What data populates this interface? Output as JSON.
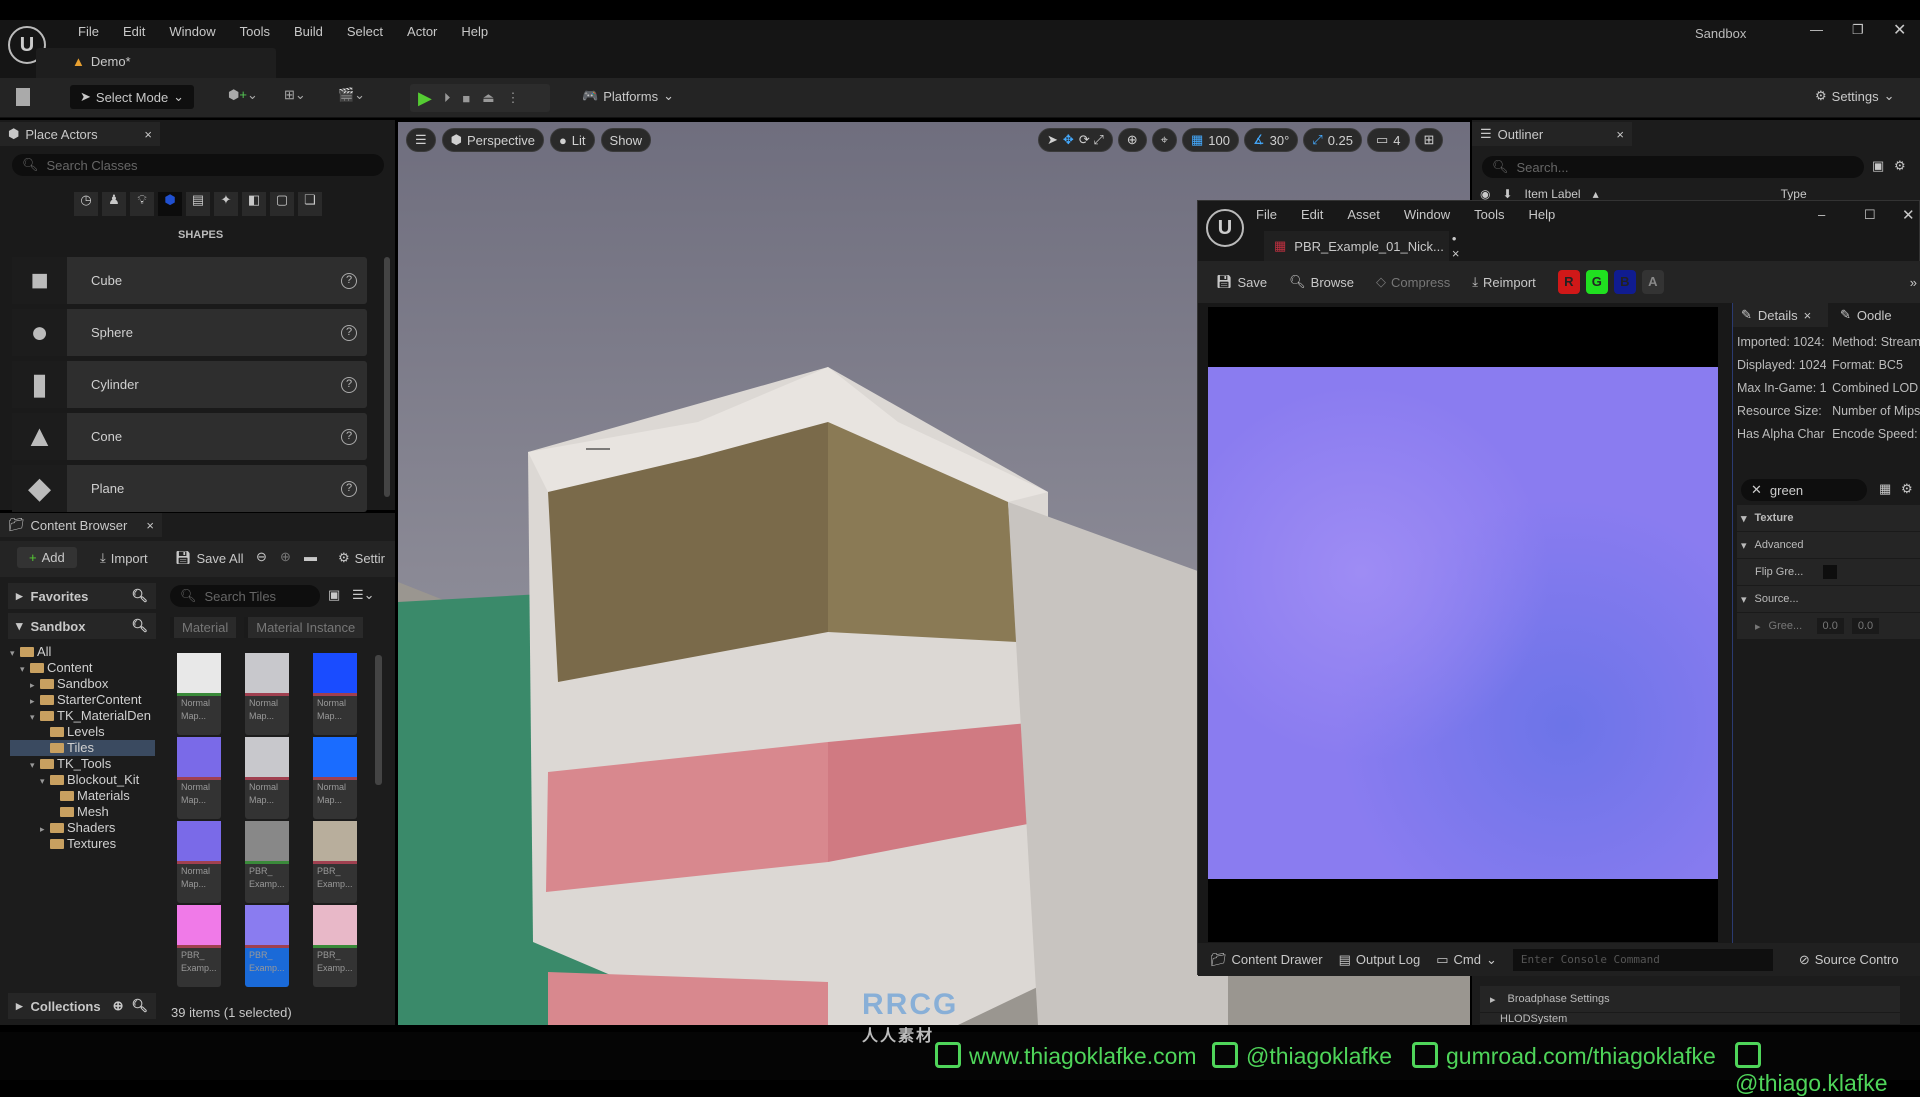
{
  "app": {
    "menu": [
      "File",
      "Edit",
      "Window",
      "Tools",
      "Build",
      "Select",
      "Actor",
      "Help"
    ],
    "project": "Sandbox",
    "level_tab": "Demo*"
  },
  "toolbar": {
    "select_mode": "Select Mode",
    "platforms": "Platforms",
    "settings": "Settings"
  },
  "place_actors": {
    "title": "Place Actors",
    "search_placeholder": "Search Classes",
    "category": "SHAPES",
    "items": [
      "Cube",
      "Sphere",
      "Cylinder",
      "Cone",
      "Plane"
    ]
  },
  "content_browser": {
    "title": "Content Browser",
    "add": "Add",
    "import": "Import",
    "save_all": "Save All",
    "settings": "Settir",
    "favorites": "Favorites",
    "sandbox": "Sandbox",
    "search_placeholder": "Search Tiles",
    "filters": [
      "Material",
      "Material Instance"
    ],
    "tree": [
      {
        "label": "All",
        "depth": 0,
        "arrow": "open"
      },
      {
        "label": "Content",
        "depth": 1,
        "arrow": "open"
      },
      {
        "label": "Sandbox",
        "depth": 2,
        "arrow": "closed"
      },
      {
        "label": "StarterContent",
        "depth": 2,
        "arrow": "closed"
      },
      {
        "label": "TK_MaterialDen",
        "depth": 2,
        "arrow": "open"
      },
      {
        "label": "Levels",
        "depth": 3,
        "arrow": ""
      },
      {
        "label": "Tiles",
        "depth": 3,
        "arrow": "",
        "selected": true
      },
      {
        "label": "TK_Tools",
        "depth": 2,
        "arrow": "open"
      },
      {
        "label": "Blockout_Kit",
        "depth": 3,
        "arrow": "open"
      },
      {
        "label": "Materials",
        "depth": 4,
        "arrow": ""
      },
      {
        "label": "Mesh",
        "depth": 4,
        "arrow": ""
      },
      {
        "label": "Shaders",
        "depth": 3,
        "arrow": "closed"
      },
      {
        "label": "Textures",
        "depth": 3,
        "arrow": ""
      }
    ],
    "tiles": [
      {
        "l1": "Normal",
        "l2": "Map...",
        "color": "#e8e8e8",
        "bar": "#3a8a3a"
      },
      {
        "l1": "Normal",
        "l2": "Map...",
        "color": "#c8c8cc",
        "bar": "#a04050"
      },
      {
        "l1": "Normal",
        "l2": "Map...",
        "color": "#1a4cff",
        "bar": "#a04050"
      },
      {
        "l1": "Normal",
        "l2": "Map...",
        "color": "#7a6ae8",
        "bar": "#a04050"
      },
      {
        "l1": "Normal",
        "l2": "Map...",
        "color": "#c8c8cc",
        "bar": "#a04050"
      },
      {
        "l1": "Normal",
        "l2": "Map...",
        "color": "#1a6cff",
        "bar": "#a04050"
      },
      {
        "l1": "Normal",
        "l2": "Map...",
        "color": "#7a6ae8",
        "bar": "#a04050"
      },
      {
        "l1": "PBR_",
        "l2": "Examp...",
        "color": "#888",
        "bar": "#3a8a3a"
      },
      {
        "l1": "PBR_",
        "l2": "Examp...",
        "color": "#b8ae9c",
        "bar": "#a04050"
      },
      {
        "l1": "PBR_",
        "l2": "Examp...",
        "color": "#f07ae8",
        "bar": "#a04050"
      },
      {
        "l1": "PBR_",
        "l2": "Examp...",
        "color": "#8a7cf0",
        "bar": "#a04050",
        "selected": true
      },
      {
        "l1": "PBR_",
        "l2": "Examp...",
        "color": "#e8b8c8",
        "bar": "#3a8a3a"
      }
    ],
    "collections": "Collections",
    "status": "39 items (1 selected)"
  },
  "viewport": {
    "perspective": "Perspective",
    "lit": "Lit",
    "show": "Show",
    "grid": "100",
    "angle": "30°",
    "scale": "0.25",
    "camera": "4"
  },
  "outliner": {
    "title": "Outliner",
    "search_placeholder": "Search...",
    "col_label": "Item Label",
    "col_type": "Type",
    "rows": [
      "Broadphase Settings",
      "HLODSystem"
    ]
  },
  "texture_editor": {
    "menu": [
      "File",
      "Edit",
      "Asset",
      "Window",
      "Tools",
      "Help"
    ],
    "tab": "PBR_Example_01_Nick...",
    "save": "Save",
    "browse": "Browse",
    "compress": "Compress",
    "reimport": "Reimport",
    "channels": [
      {
        "l": "R",
        "c": "#d01818"
      },
      {
        "l": "G",
        "c": "#20e020"
      },
      {
        "l": "B",
        "c": "#101c90"
      },
      {
        "l": "A",
        "c": "#333333"
      }
    ],
    "details_tab": "Details",
    "oodle_tab": "Oodle",
    "info_left": [
      "Imported: 1024:",
      "Displayed: 1024",
      "Max In-Game: 1",
      "Resource Size:",
      "Has Alpha Char"
    ],
    "info_right": [
      "Method: Stream",
      "Format: BC5",
      "Combined LOD",
      "Number of Mips",
      "Encode Speed:"
    ],
    "filter": "green",
    "sections": {
      "texture": "Texture",
      "advanced": "Advanced",
      "flip": "Flip Gre...",
      "source": "Source...",
      "green": "Gree...",
      "v1": "0.0",
      "v2": "0.0"
    },
    "texture_color": "#8a7cf0"
  },
  "statusbar": {
    "content_drawer": "Content Drawer",
    "output_log": "Output Log",
    "cmd": "Cmd",
    "console_placeholder": "Enter Console Command",
    "source_control": "Source Contro"
  },
  "watermark": {
    "logo": "RRCG 人人素材",
    "site": "www.thiagoklafke.com",
    "twitter": "@thiagoklafke",
    "gumroad": "gumroad.com/thiagoklafke",
    "instagram": "@thiago.klafke"
  }
}
